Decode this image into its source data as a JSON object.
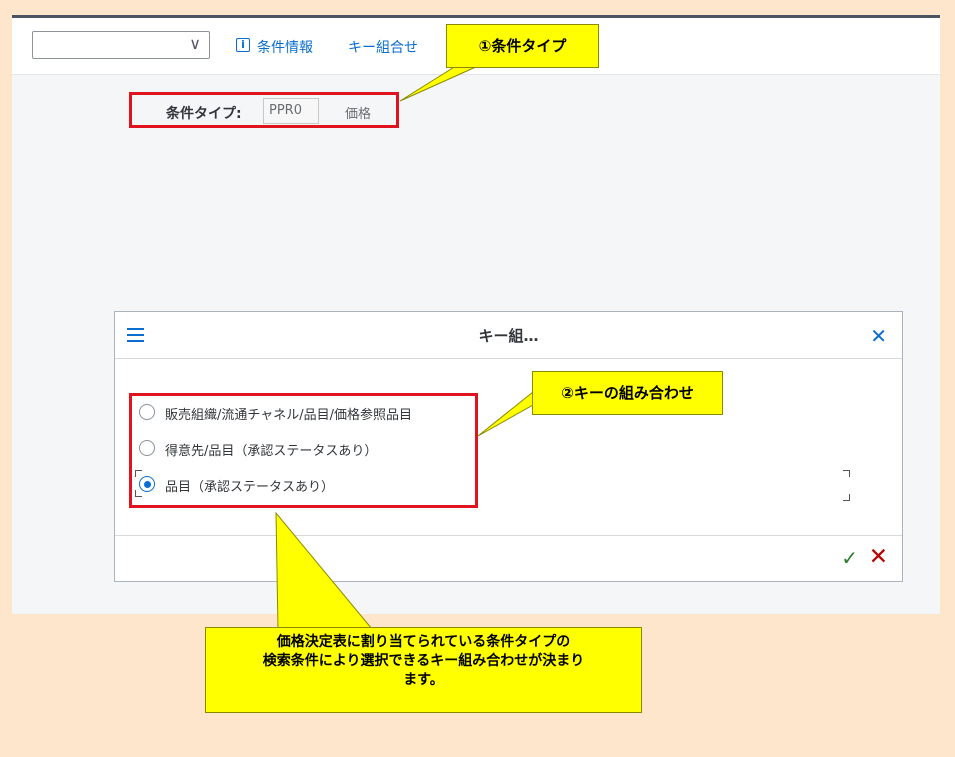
{
  "toolbar": {
    "dropdown_value": "",
    "condition_info_label": "条件情報",
    "key_combination_label": "キー組合せ"
  },
  "condition": {
    "label": "条件タイプ:",
    "code": "PPR0",
    "description": "価格"
  },
  "dialog": {
    "title": "キー組…",
    "options": [
      {
        "label": "販売組織/流通チャネル/品目/価格参照品目",
        "selected": false
      },
      {
        "label": "得意先/品目（承認ステータスあり）",
        "selected": false
      },
      {
        "label": "品目（承認ステータスあり）",
        "selected": true
      }
    ]
  },
  "callouts": {
    "condition_type": "①条件タイプ",
    "key_combination": "②キーの組み合わせ",
    "note_lines": [
      "価格決定表に割り当てられている条件タイプの",
      "検索条件により選択できるキー組み合わせが決まり",
      "ます。"
    ]
  },
  "icons": {
    "dropdown": "chevron-down-icon",
    "info": "info-icon",
    "menu": "menu-icon",
    "close": "close-icon",
    "ok": "checkmark-icon",
    "cancel": "cancel-icon"
  },
  "colors": {
    "background": "#fde6cc",
    "accent": "#0a6ed1",
    "highlight_border": "#e0141e",
    "callout": "#ffff00",
    "ok": "#2b7d2b",
    "cancel": "#bb0000"
  }
}
